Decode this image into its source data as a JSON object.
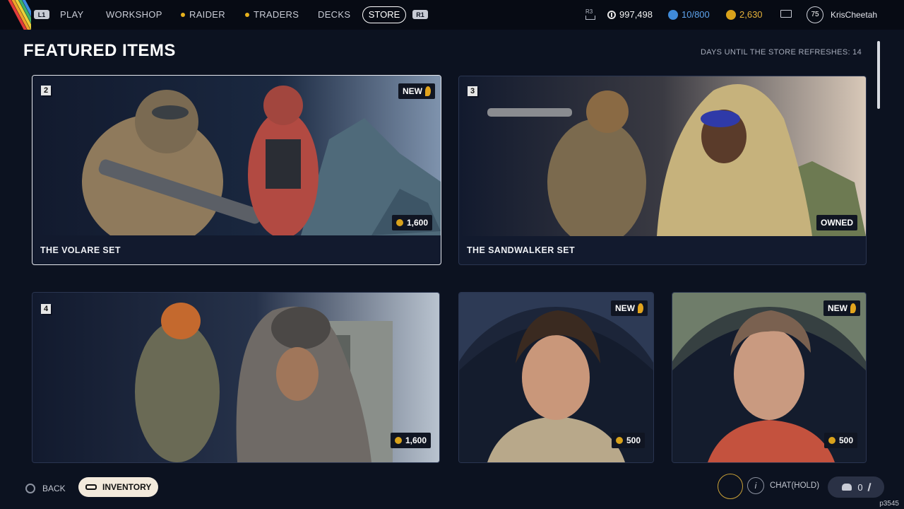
{
  "nav": {
    "hint_left": "L1",
    "hint_right": "R1",
    "items": [
      {
        "label": "PLAY",
        "dot": false
      },
      {
        "label": "WORKSHOP",
        "dot": false
      },
      {
        "label": "RAIDER",
        "dot": true
      },
      {
        "label": "TRADERS",
        "dot": true
      },
      {
        "label": "DECKS",
        "dot": false
      }
    ],
    "active": "STORE",
    "r3_hint": "R3",
    "currency_white": "997,498",
    "currency_blue": "10/800",
    "currency_gold": "2,630",
    "level": "75",
    "username": "KrisCheetah"
  },
  "header": {
    "title": "FEATURED ITEMS",
    "refresh_text": "DAYS UNTIL THE STORE REFRESHES: 14"
  },
  "cards": [
    {
      "num": "2",
      "label": "THE VOLARE SET",
      "tag": "NEW",
      "price": "1,600",
      "selected": true
    },
    {
      "num": "3",
      "label": "THE SANDWALKER SET",
      "status": "OWNED"
    },
    {
      "num": "4",
      "price": "1,600"
    },
    {
      "tag": "NEW",
      "price": "500"
    },
    {
      "tag": "NEW",
      "price": "500"
    }
  ],
  "footer": {
    "back_label": "BACK",
    "inventory_label": "INVENTORY",
    "chat_label": "CHAT(HOLD)",
    "friends_count": "0",
    "build": "p3545"
  },
  "colors": {
    "background": "#0c1220",
    "accent_gold": "#d9a21b",
    "accent_blue": "#3f8ad8"
  }
}
